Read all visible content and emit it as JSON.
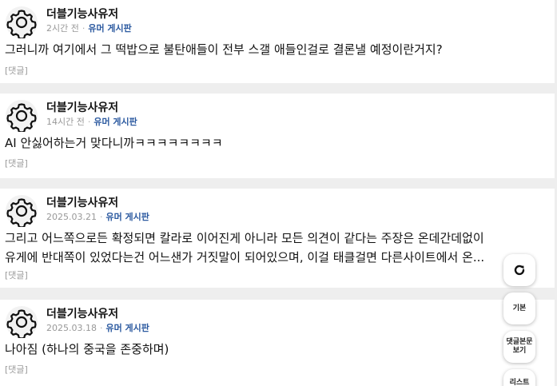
{
  "posts": [
    {
      "author": "더블기능사유저",
      "time": "2시간 전",
      "separator": "·",
      "board": "유머 게시판",
      "text": "그러니까 여기에서 그 떡밥으로 불탄애들이 전부 스갤 애들인걸로 결론낼 예정이란거지?",
      "reply": "[댓글]"
    },
    {
      "author": "더블기능사유저",
      "time": "14시간 전",
      "separator": "·",
      "board": "유머 게시판",
      "text": "AI 안싫어하는거 맞다니까ㅋㅋㅋㅋㅋㅋㅋㅋ",
      "reply": "[댓글]"
    },
    {
      "author": "더블기능사유저",
      "time": "2025.03.21",
      "separator": "·",
      "board": "유머 게시판",
      "text": "그리고 어느쪽으로든 확정되면 칼라로 이어진게 아니라 모든 의견이 같다는 주장은 온데간데없이 유게에 반대쪽이 있었다는건 어느샌가 거짓말이 되어있으며, 이걸 태클걸면 다른사이트에서 온...",
      "reply": "[댓글]"
    },
    {
      "author": "더블기능사유저",
      "time": "2025.03.18",
      "separator": "·",
      "board": "유머 게시판",
      "text": "나아짐 (하나의 중국을 존중하며)",
      "reply": "[댓글]"
    }
  ],
  "floating_buttons": {
    "refresh_icon": "refresh-icon",
    "default_label": "기본",
    "comment_body_label": "댓글본문\n보기",
    "list_label": "리스트"
  },
  "colors": {
    "background": "#eeeeee",
    "card": "#ffffff",
    "board_link": "#2c5aa0",
    "muted": "#999999"
  }
}
